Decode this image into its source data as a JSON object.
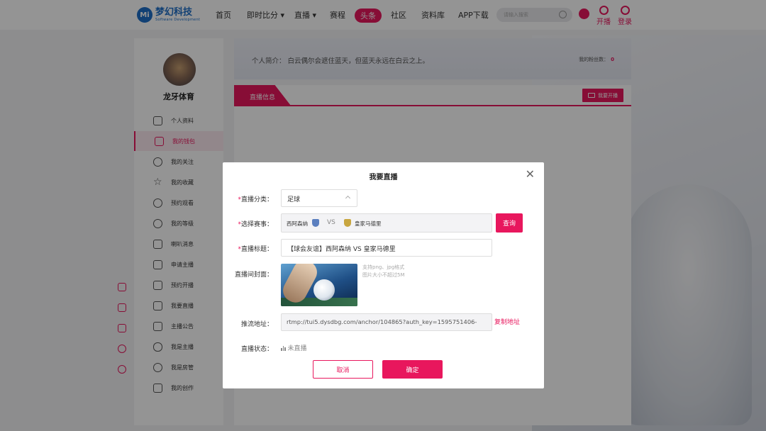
{
  "colors": {
    "accent": "#e8175d",
    "brand": "#1e6fc8"
  },
  "header": {
    "logo_mark": "Mi",
    "logo_name": "梦幻科技",
    "logo_sub": "Software Development",
    "nav": [
      {
        "label": "首页"
      },
      {
        "label": "即时比分",
        "has_dropdown": true
      },
      {
        "label": "直播",
        "has_dropdown": true
      },
      {
        "label": "赛程"
      },
      {
        "label": "头条",
        "active": true
      },
      {
        "label": "社区"
      },
      {
        "label": "资料库"
      },
      {
        "label": "APP下载"
      }
    ],
    "search_placeholder": "请输入搜索",
    "start_live_label": "开播",
    "login_label": "登录"
  },
  "sidebar": {
    "username": "龙牙体育",
    "items": [
      {
        "label": "个人资料",
        "icon": "id-card-icon"
      },
      {
        "label": "我的钱包",
        "icon": "wallet-icon",
        "active": true
      },
      {
        "label": "我的关注",
        "icon": "heart-icon"
      },
      {
        "label": "我的收藏",
        "icon": "star-icon"
      },
      {
        "label": "预约观看",
        "icon": "alarm-icon"
      },
      {
        "label": "我的等级",
        "icon": "level-heart-icon"
      },
      {
        "label": "喇叭消息",
        "icon": "megaphone-icon"
      },
      {
        "label": "申请主播",
        "icon": "video-camera-icon"
      },
      {
        "label": "预约开播",
        "icon": "tv-play-icon"
      },
      {
        "label": "我要直播",
        "icon": "live-camera-icon"
      },
      {
        "label": "主播公告",
        "icon": "notice-board-icon"
      },
      {
        "label": "我是主播",
        "icon": "microphone-icon"
      },
      {
        "label": "我是房管",
        "icon": "user-manage-icon"
      },
      {
        "label": "我的创作",
        "icon": "document-icon"
      }
    ]
  },
  "intro": {
    "label": "个人简介：",
    "text": "白云偶尔会遮住蓝天，但蓝天永远在白云之上。",
    "fans_label": "我的粉丝数：",
    "fans_count": "0"
  },
  "panel": {
    "tab_label": "直播信息",
    "start_button_label": "我要开播"
  },
  "modal": {
    "title": "我要直播",
    "category_label": "直播分类：",
    "category_value": "足球",
    "match_label": "选择赛事：",
    "home_team": "西阿森纳",
    "vs": "VS",
    "away_team": "皇家马德里",
    "query_label": "查询",
    "title_label": "直播标题：",
    "title_value": "【球会友谊】西阿森纳 VS 皇家马德里",
    "cover_label": "直播间封面：",
    "cover_hint_1": "支持png、jpg格式",
    "cover_hint_2": "图片大小不超过5M",
    "push_label": "推流地址：",
    "push_url": "rtmp://tui5.dysdbg.com/anchor/104865?auth_key=1595751406-",
    "copy_label": "复制地址",
    "status_label": "直播状态：",
    "status_value": "未直播",
    "cancel_label": "取消",
    "confirm_label": "确定"
  }
}
